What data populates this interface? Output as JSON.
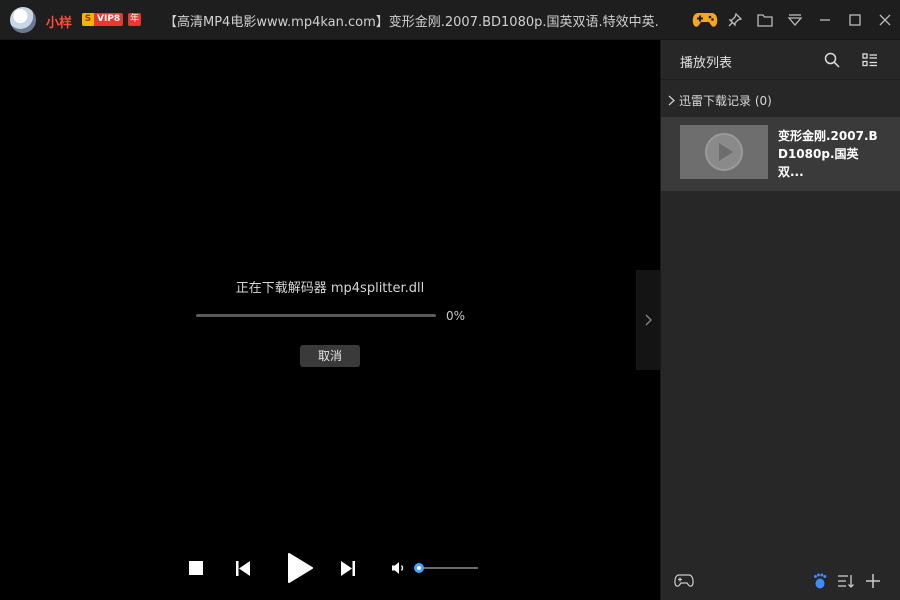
{
  "titlebar": {
    "username": "小样",
    "vip_badge_s": "S",
    "vip_badge_text": "VIP8",
    "year_badge": "年",
    "window_title": "【高清MP4电影www.mp4kan.com】变形金刚.2007.BD1080p.国英双语.特效中英...",
    "icons": [
      "gamepad-icon",
      "pin-icon",
      "folder-icon",
      "dropdown-menu-icon",
      "minimize-icon",
      "maximize-icon",
      "close-icon"
    ]
  },
  "player": {
    "download_message": "正在下载解码器 mp4splitter.dll",
    "progress_text": "0%",
    "progress_value": 0,
    "cancel_label": "取消",
    "volume_level": 0.02,
    "accent_color": "#4aa2ff"
  },
  "playlist": {
    "title": "播放列表",
    "group_label": "迅雷下载记录 (0)",
    "items": [
      {
        "name": "变形金刚.2007.BD1080p.国英双...",
        "sub": "--"
      }
    ]
  }
}
